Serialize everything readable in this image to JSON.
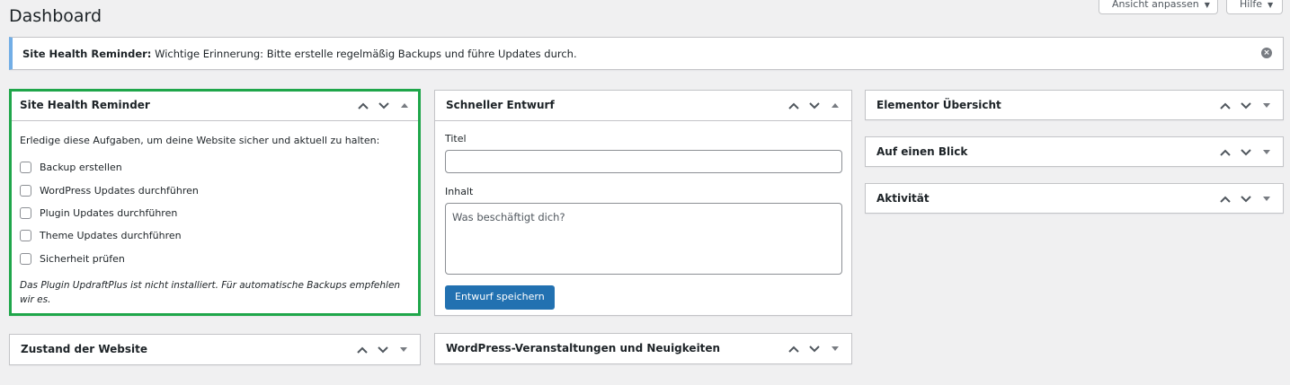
{
  "page": {
    "title": "Dashboard"
  },
  "screen_tabs": {
    "options_label": "Ansicht anpassen",
    "help_label": "Hilfe"
  },
  "notice": {
    "title": "Site Health Reminder:",
    "message": "Wichtige Erinnerung: Bitte erstelle regelmäßig Backups und führe Updates durch."
  },
  "widgets": {
    "site_health_reminder": {
      "title": "Site Health Reminder",
      "intro": "Erledige diese Aufgaben, um deine Website sicher und aktuell zu halten:",
      "tasks": [
        "Backup erstellen",
        "WordPress Updates durchführen",
        "Plugin Updates durchführen",
        "Theme Updates durchführen",
        "Sicherheit prüfen"
      ],
      "hint": "Das Plugin UpdraftPlus ist nicht installiert. Für automatische Backups empfehlen wir es.",
      "highlight_color": "#1fa64a"
    },
    "site_health_status": {
      "title": "Zustand der Website"
    },
    "quick_draft": {
      "title": "Schneller Entwurf",
      "title_label": "Titel",
      "title_value": "",
      "content_label": "Inhalt",
      "content_placeholder": "Was beschäftigt dich?",
      "save_label": "Entwurf speichern"
    },
    "events_news": {
      "title": "WordPress-Veranstaltungen und Neuigkeiten"
    },
    "elementor_overview": {
      "title": "Elementor Übersicht"
    },
    "at_a_glance": {
      "title": "Auf einen Blick"
    },
    "activity": {
      "title": "Aktivität"
    }
  },
  "colors": {
    "accent": "#2271b1",
    "notice_border": "#72aee6",
    "background": "#f0f0f1"
  },
  "icons": {
    "move_up": "chevron-up-icon",
    "move_down": "chevron-down-icon",
    "toggle": "triangle-toggle-icon",
    "dismiss": "dismiss-icon"
  }
}
